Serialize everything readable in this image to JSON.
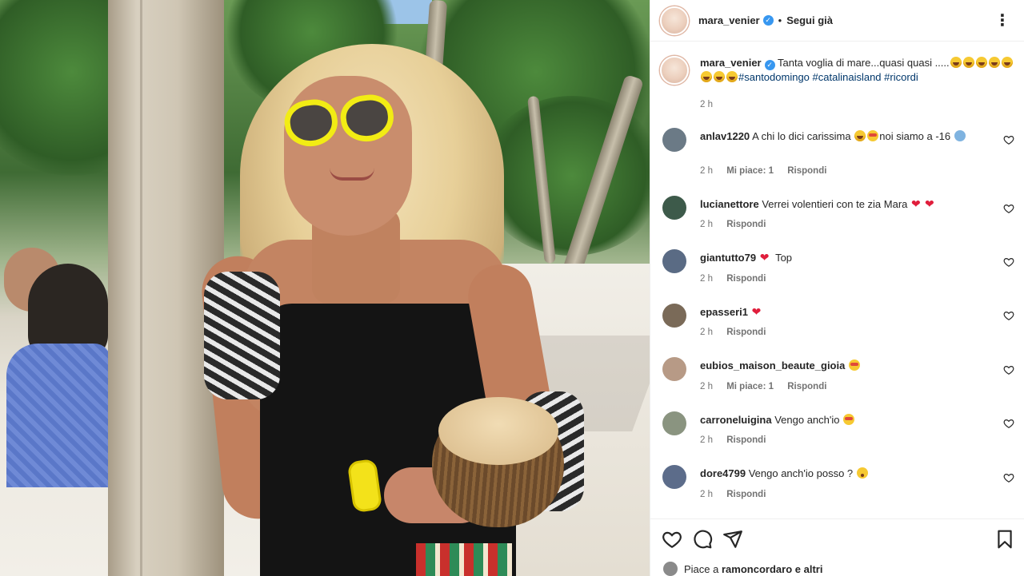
{
  "header": {
    "username": "mara_venier",
    "follow_label": "Segui già",
    "separator": "•"
  },
  "caption": {
    "username": "mara_venier",
    "text": "Tanta voglia di mare...quasi quasi .....",
    "hashtags": [
      "#santodomingo",
      "#catalinaisland",
      "#ricordi"
    ],
    "time": "2 h"
  },
  "comments": [
    {
      "username": "anlav1220",
      "text": "A chi lo dici carissima",
      "text_after": "noi siamo a -16",
      "time": "2 h",
      "likes_label": "Mi piace: 1",
      "reply_label": "Rispondi",
      "avatar_color": "#6b7a86"
    },
    {
      "username": "lucianettore",
      "text": "Verrei volentieri con te zia Mara",
      "time": "2 h",
      "reply_label": "Rispondi",
      "avatar_color": "#3d5a4a"
    },
    {
      "username": "giantutto79",
      "text": "Top",
      "time": "2 h",
      "reply_label": "Rispondi",
      "avatar_color": "#5a6b84"
    },
    {
      "username": "epasseri1",
      "text": "",
      "time": "2 h",
      "reply_label": "Rispondi",
      "avatar_color": "#7a6a58"
    },
    {
      "username": "eubios_maison_beaute_gioia",
      "text": "",
      "time": "2 h",
      "likes_label": "Mi piace: 1",
      "reply_label": "Rispondi",
      "avatar_color": "#b79a86"
    },
    {
      "username": "carroneluigina",
      "text": "Vengo anch'io",
      "time": "2 h",
      "reply_label": "Rispondi",
      "avatar_color": "#8a9480"
    },
    {
      "username": "dore4799",
      "text": "Vengo anch'io posso ?",
      "time": "2 h",
      "reply_label": "Rispondi",
      "avatar_color": "#5c6c8a"
    }
  ],
  "footer": {
    "likes_prefix": "Piace a ",
    "likes_user": "ramoncordaro",
    "likes_suffix": " e altri"
  },
  "icons": {
    "like": "heart-icon",
    "comment": "comment-icon",
    "share": "share-icon",
    "save": "bookmark-icon",
    "more": "more-options-icon"
  },
  "colors": {
    "verified": "#3797f0",
    "hashtag": "#00376b",
    "muted": "#737373"
  }
}
